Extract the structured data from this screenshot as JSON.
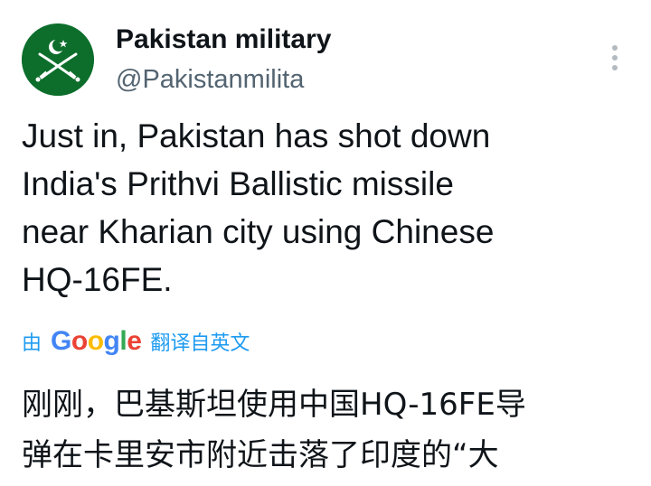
{
  "author": {
    "display_name": "Pakistan military",
    "handle": "@Pakistanmilita",
    "avatar_icon": "crossed-swords-crescent-icon",
    "avatar_color": "#0d6e2c"
  },
  "menu": {
    "icon": "more-vertical-icon"
  },
  "tweet": {
    "text": "Just in, Pakistan has shot down\nIndia's Prithvi Ballistic missile\nnear Kharian city using Chinese\nHQ-16FE."
  },
  "translation": {
    "prefix": "由",
    "google_letters": [
      "G",
      "o",
      "o",
      "g",
      "l",
      "e"
    ],
    "suffix": "翻译自英文",
    "text": "刚刚，巴基斯坦使用中国HQ-16FE导\n弹在卡里安市附近击落了印度的“大"
  },
  "colors": {
    "link_blue": "#1d9bf0",
    "handle_gray": "#536471",
    "text": "#0f1419"
  }
}
